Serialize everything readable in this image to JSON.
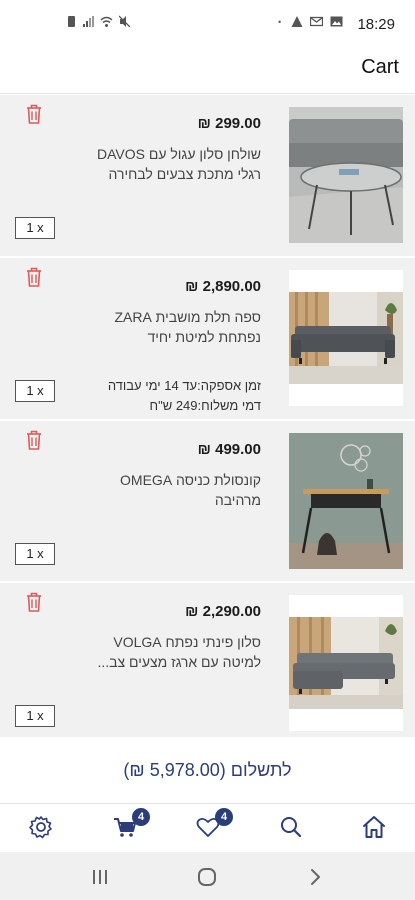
{
  "status_bar": {
    "time": "18:29"
  },
  "header": {
    "title": "Cart"
  },
  "cart": {
    "items": [
      {
        "price": "299.00 ₪",
        "desc_line1": "שולחן סלון עגול עם DAVOS",
        "desc_line2": "רגלי מתכת צבעים לבחירה",
        "quantity": "1 x",
        "image": "round-coffee-table-photo"
      },
      {
        "price": "2,890.00 ₪",
        "desc_line1": "ספה תלת מושבית ZARA",
        "desc_line2": "נפתחת למיטת יחיד",
        "delivery_line1": "זמן אספקה:עד 14 ימי עבודה",
        "delivery_line2": "דמי משלוח:249 ש\"ח",
        "quantity": "1 x",
        "image": "grey-sofa-photo"
      },
      {
        "price": "499.00 ₪",
        "desc_line1": "קונסולת כניסה OMEGA",
        "desc_line2": "מרהיבה",
        "quantity": "1 x",
        "image": "entry-console-photo"
      },
      {
        "price": "2,290.00 ₪",
        "desc_line1": "סלון פינתי נפתח VOLGA",
        "desc_line2": "למיטה עם ארגז מצעים צב...",
        "quantity": "1 x",
        "image": "corner-sofa-photo"
      }
    ]
  },
  "checkout": {
    "label": "לתשלום (5,978.00 ₪)"
  },
  "nav": {
    "cart_badge": "4",
    "wishlist_badge": "4",
    "items": [
      "settings-icon",
      "cart-icon",
      "heart-icon",
      "search-icon",
      "home-icon"
    ]
  },
  "colors": {
    "accent": "#2c3e7a",
    "trash": "#e05a5a",
    "item_bg": "#f1f1f1"
  }
}
